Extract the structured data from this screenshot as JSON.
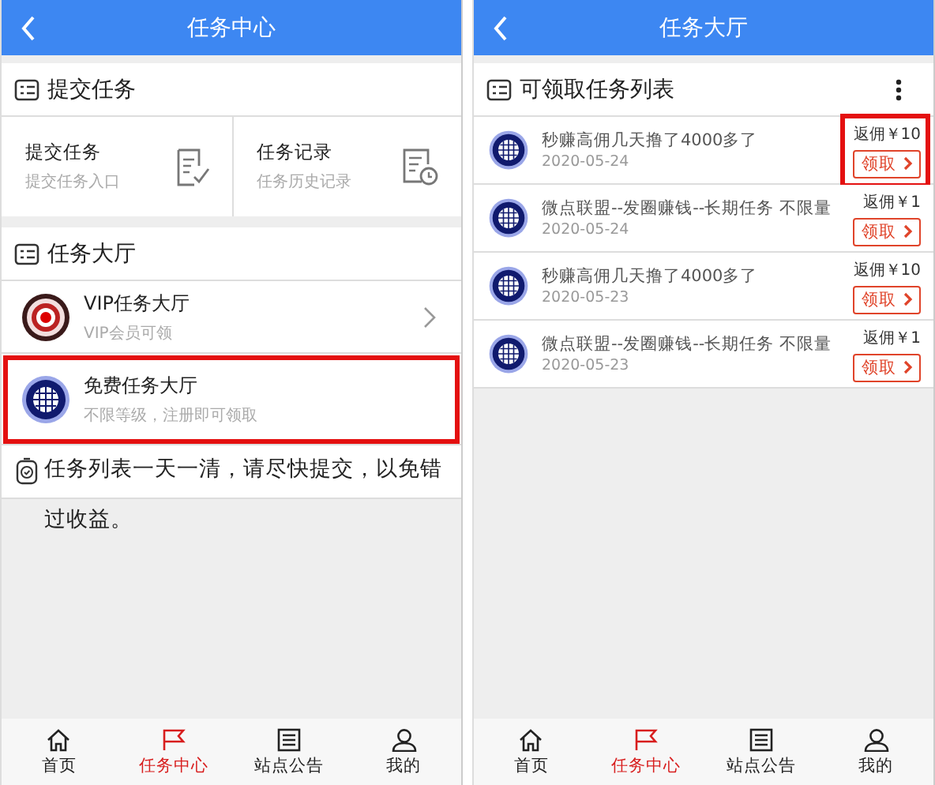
{
  "task_center": {
    "header": {
      "title": "任务中心"
    },
    "submit_section": {
      "title": "提交任务",
      "cards": [
        {
          "title": "提交任务",
          "subtitle": "提交任务入口"
        },
        {
          "title": "任务记录",
          "subtitle": "任务历史记录"
        }
      ]
    },
    "hall_section": {
      "title": "任务大厅",
      "entries": [
        {
          "kind": "vip",
          "title": "VIP任务大厅",
          "subtitle": "VIP会员可领",
          "highlighted": false
        },
        {
          "kind": "free",
          "title": "免费任务大厅",
          "subtitle": "不限等级，注册即可领取",
          "highlighted": true
        }
      ]
    },
    "notice": "任务列表一天一清，请尽快提交，以免错过收益。",
    "tab_bar": [
      {
        "label": "首页",
        "selected": false
      },
      {
        "label": "任务中心",
        "selected": true
      },
      {
        "label": "站点公告",
        "selected": false
      },
      {
        "label": "我的",
        "selected": false
      }
    ]
  },
  "task_hall": {
    "header": {
      "title": "任务大厅"
    },
    "list_title": "可领取任务列表",
    "tasks": [
      {
        "title": "秒赚高佣几天撸了4000多了",
        "date": "2020-05-24",
        "reward": "返佣￥10",
        "action": "领取",
        "highlighted": true
      },
      {
        "title": "微点联盟--发圈赚钱--长期任务 不限量",
        "date": "2020-05-24",
        "reward": "返佣￥1",
        "action": "领取",
        "highlighted": false
      },
      {
        "title": "秒赚高佣几天撸了4000多了",
        "date": "2020-05-23",
        "reward": "返佣￥10",
        "action": "领取",
        "highlighted": false
      },
      {
        "title": "微点联盟--发圈赚钱--长期任务 不限量",
        "date": "2020-05-23",
        "reward": "返佣￥1",
        "action": "领取",
        "highlighted": false
      }
    ],
    "tab_bar": [
      {
        "label": "首页",
        "selected": false
      },
      {
        "label": "任务中心",
        "selected": true
      },
      {
        "label": "站点公告",
        "selected": false
      },
      {
        "label": "我的",
        "selected": false
      }
    ]
  }
}
